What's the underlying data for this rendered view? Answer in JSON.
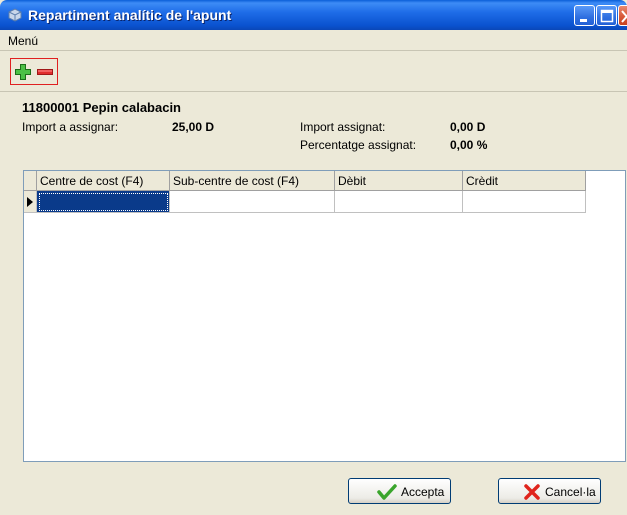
{
  "window": {
    "title": "Repartiment analític de l'apunt"
  },
  "menu": {
    "items": [
      "Menú"
    ]
  },
  "toolbar": {
    "add_icon": "plus-icon",
    "remove_icon": "minus-icon"
  },
  "account": {
    "title": "11800001 Pepin calabacin",
    "import_a_assignar_label": "Import a assignar:",
    "import_a_assignar_value": "25,00 D",
    "import_assignat_label": "Import assignat:",
    "import_assignat_value": "0,00 D",
    "percentatge_label": "Percentatge assignat:",
    "percentatge_value": "0,00 %"
  },
  "grid": {
    "columns": [
      "Centre de cost (F4)",
      "Sub-centre de cost (F4)",
      "Dèbit",
      "Crèdit"
    ],
    "rows": [
      [
        "",
        "",
        "",
        ""
      ]
    ]
  },
  "buttons": {
    "accept": "Accepta",
    "cancel": "Cancel·la"
  },
  "colors": {
    "titlebar": "#0a52cf",
    "selection": "#0a3a8a",
    "accept_check": "#3aa52c",
    "cancel_x": "#e0241c"
  }
}
